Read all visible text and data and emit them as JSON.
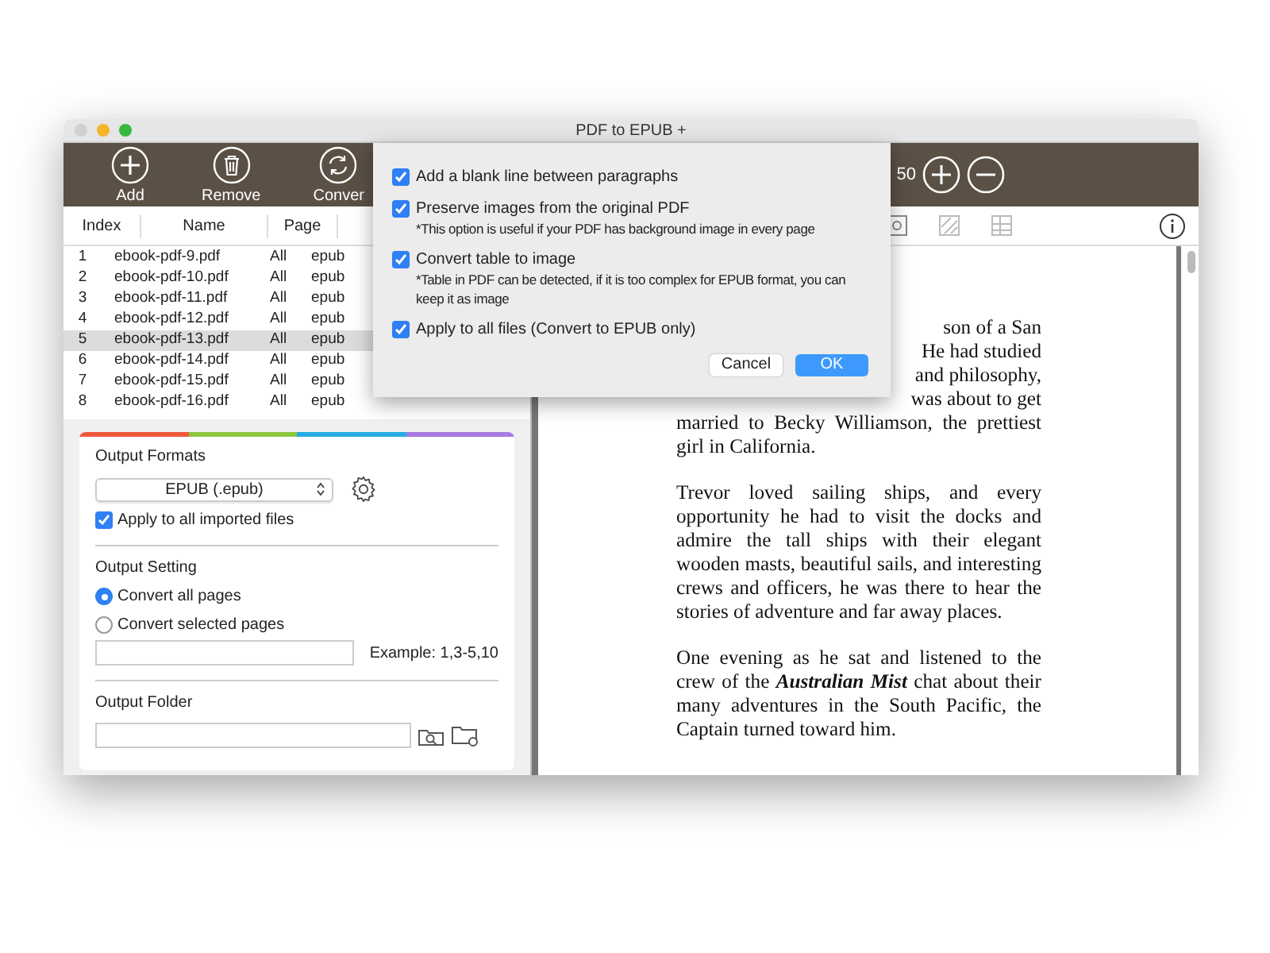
{
  "window": {
    "title": "PDF to EPUB +"
  },
  "toolbar": {
    "buttons": [
      {
        "label": "Add",
        "kind": "add"
      },
      {
        "label": "Remove",
        "kind": "remove"
      },
      {
        "label": "Conver",
        "kind": "convert"
      }
    ],
    "zoom_value": "50"
  },
  "file_table": {
    "columns": [
      "Index",
      "Name",
      "Page"
    ],
    "rows": [
      {
        "index": "1",
        "name": "ebook-pdf-9.pdf",
        "page": "All",
        "column_4": "epub",
        "selected": false
      },
      {
        "index": "2",
        "name": "ebook-pdf-10.pdf",
        "page": "All",
        "column_4": "epub",
        "selected": false
      },
      {
        "index": "3",
        "name": "ebook-pdf-11.pdf",
        "page": "All",
        "column_4": "epub",
        "selected": false
      },
      {
        "index": "4",
        "name": "ebook-pdf-12.pdf",
        "page": "All",
        "column_4": "epub",
        "selected": false
      },
      {
        "index": "5",
        "name": "ebook-pdf-13.pdf",
        "page": "All",
        "column_4": "epub",
        "selected": true
      },
      {
        "index": "6",
        "name": "ebook-pdf-14.pdf",
        "page": "All",
        "column_4": "epub",
        "selected": false
      },
      {
        "index": "7",
        "name": "ebook-pdf-15.pdf",
        "page": "All",
        "column_4": "epub",
        "selected": false
      },
      {
        "index": "8",
        "name": "ebook-pdf-16.pdf",
        "page": "All",
        "column_4": "epub",
        "selected": false
      }
    ]
  },
  "output_panel": {
    "formats_title": "Output Formats",
    "format_value": "EPUB (.epub)",
    "apply_all": {
      "label": "Apply to all imported files",
      "checked": true
    },
    "setting_title": "Output Setting",
    "page_options": [
      {
        "label": "Convert all pages",
        "selected": true
      },
      {
        "label": "Convert selected pages",
        "selected": false
      }
    ],
    "range_hint": "Example: 1,3-5,10",
    "folder_title": "Output Folder"
  },
  "dialog": {
    "options": [
      {
        "label": "Add a blank line between paragraphs",
        "checked": true
      },
      {
        "label": "Preserve images from the original PDF",
        "note": "*This option is useful if your PDF has background image in every page",
        "checked": true
      },
      {
        "label": "Convert table to image",
        "note": "*Table in PDF can be detected, if it is too complex for EPUB format, you can keep it as image",
        "checked": true
      },
      {
        "label": "Apply to all files (Convert to EPUB only)",
        "checked": true
      }
    ],
    "buttons": [
      {
        "label": "Cancel",
        "kind": "secondary"
      },
      {
        "label": "OK",
        "kind": "primary"
      }
    ]
  },
  "document": {
    "paragraphs": [
      {
        "kind": "partial",
        "lines": [
          "son of a San",
          "He had studied",
          "and philosophy,",
          "was about to get"
        ]
      },
      {
        "kind": "continued",
        "text": "married to Becky Williamson, the prettiest girl in California."
      },
      {
        "kind": "text",
        "text": "Trevor loved sailing ships, and every opportunity he had to visit the docks and admire the tall ships with their elegant wooden masts, beautiful sails, and interesting crews and officers, he was there to hear the stories of adventure and far away places."
      },
      {
        "kind": "text",
        "text": "One evening as he sat and listened to the crew of the **Australian Mist** chat about their many adventures in the South Pacific, the Captain turned toward him."
      }
    ]
  }
}
